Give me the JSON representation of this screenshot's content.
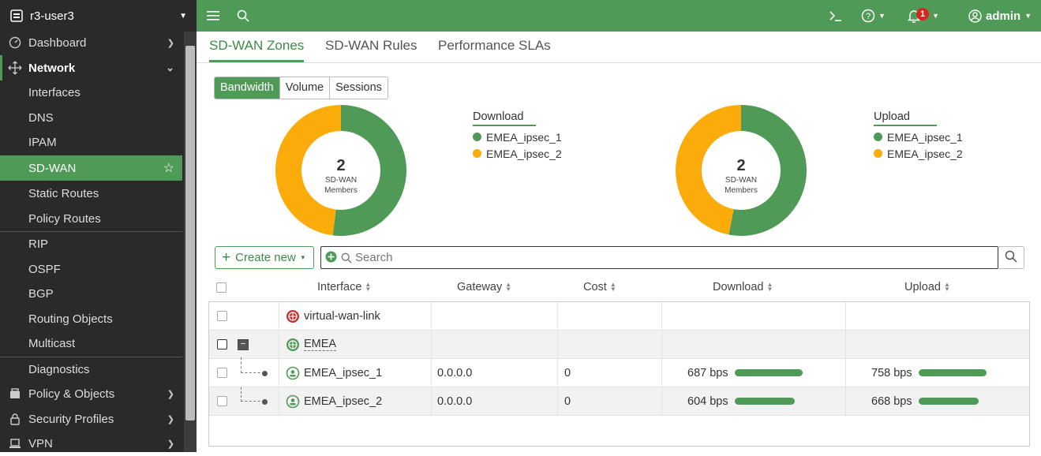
{
  "sidebar": {
    "device": "r3-user3",
    "items": [
      {
        "label": "Dashboard"
      },
      {
        "label": "Network"
      },
      {
        "label": "Interfaces"
      },
      {
        "label": "DNS"
      },
      {
        "label": "IPAM"
      },
      {
        "label": "SD-WAN"
      },
      {
        "label": "Static Routes"
      },
      {
        "label": "Policy Routes"
      },
      {
        "label": "RIP"
      },
      {
        "label": "OSPF"
      },
      {
        "label": "BGP"
      },
      {
        "label": "Routing Objects"
      },
      {
        "label": "Multicast"
      },
      {
        "label": "Diagnostics"
      },
      {
        "label": "Policy & Objects"
      },
      {
        "label": "Security Profiles"
      },
      {
        "label": "VPN"
      }
    ]
  },
  "topbar": {
    "notifications": "1",
    "user": "admin"
  },
  "tabs": [
    "SD-WAN Zones",
    "SD-WAN Rules",
    "Performance SLAs"
  ],
  "toggle": [
    "Bandwidth",
    "Volume",
    "Sessions"
  ],
  "donuts": [
    {
      "count": "2",
      "label1": "SD-WAN",
      "label2": "Members",
      "legend_title": "Download",
      "legend": [
        "EMEA_ipsec_1",
        "EMEA_ipsec_2"
      ],
      "values": [
        52,
        48
      ]
    },
    {
      "count": "2",
      "label1": "SD-WAN",
      "label2": "Members",
      "legend_title": "Upload",
      "legend": [
        "EMEA_ipsec_1",
        "EMEA_ipsec_2"
      ],
      "values": [
        53,
        47
      ]
    }
  ],
  "colors": {
    "green": "#4e9a56",
    "orange": "#fbab0a",
    "alert": "#d9261c"
  },
  "toolbar": {
    "create_label": "Create new",
    "search_placeholder": "Search"
  },
  "table": {
    "headers": [
      "Interface",
      "Gateway",
      "Cost",
      "Download",
      "Upload"
    ],
    "rows": [
      {
        "interface": "virtual-wan-link",
        "gateway": "",
        "cost": "",
        "download": "",
        "upload": ""
      },
      {
        "interface": "EMEA",
        "gateway": "",
        "cost": "",
        "download": "",
        "upload": ""
      },
      {
        "interface": "EMEA_ipsec_1",
        "gateway": "0.0.0.0",
        "cost": "0",
        "download": "687 bps",
        "download_bar": 0.86,
        "upload": "758 bps",
        "upload_bar": 0.86
      },
      {
        "interface": "EMEA_ipsec_2",
        "gateway": "0.0.0.0",
        "cost": "0",
        "download": "604 bps",
        "download_bar": 0.76,
        "upload": "668 bps",
        "upload_bar": 0.76
      }
    ]
  }
}
